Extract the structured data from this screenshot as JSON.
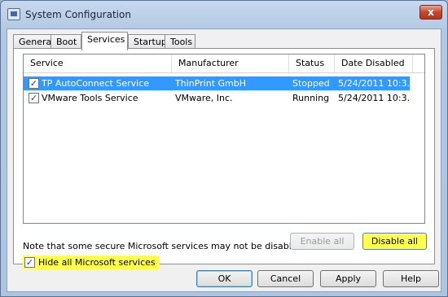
{
  "window": {
    "title": "System Configuration",
    "close_label": "x"
  },
  "tabs": [
    {
      "label": "General"
    },
    {
      "label": "Boot"
    },
    {
      "label": "Services"
    },
    {
      "label": "Startup"
    },
    {
      "label": "Tools"
    }
  ],
  "active_tab": "Services",
  "services": {
    "columns": [
      "Service",
      "Manufacturer",
      "Status",
      "Date Disabled"
    ],
    "rows": [
      {
        "checked": true,
        "name": "TP AutoConnect Service",
        "manufacturer": "ThinPrint GmbH",
        "status": "Stopped",
        "date_disabled": "5/24/2011 10:3...",
        "selected": true
      },
      {
        "checked": true,
        "name": "VMware Tools Service",
        "manufacturer": "VMware, Inc.",
        "status": "Running",
        "date_disabled": "5/24/2011 10:3...",
        "selected": false
      }
    ]
  },
  "note": "Note that some secure Microsoft services may not be disabled.",
  "buttons": {
    "enable_all": "Enable all",
    "disable_all": "Disable all",
    "ok": "OK",
    "cancel": "Cancel",
    "apply": "Apply",
    "help": "Help"
  },
  "hide_ms": {
    "label": "Hide all Microsoft services",
    "checked": true
  },
  "colors": {
    "selection": "#3399ff",
    "highlight": "#ffff4d"
  }
}
